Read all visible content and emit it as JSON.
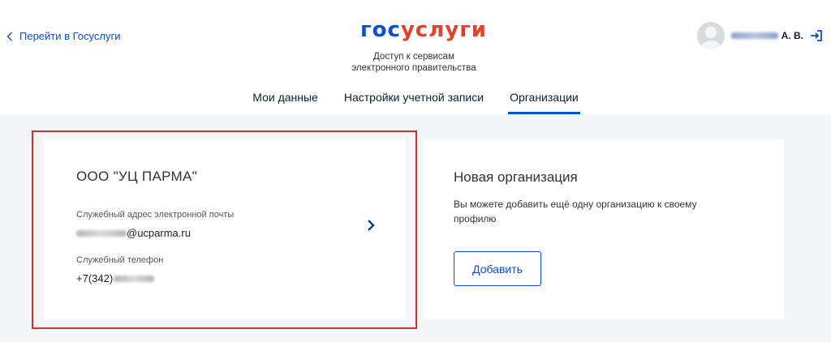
{
  "header": {
    "back_link": "Перейти в Госуслуги",
    "logo_part1": "гос",
    "logo_part2": "услуги",
    "subtitle_line1": "Доступ к сервисам",
    "subtitle_line2": "электронного правительства",
    "user_initials": "А. В."
  },
  "tabs": [
    {
      "label": "Мои данные",
      "active": false
    },
    {
      "label": "Настройки учетной записи",
      "active": false
    },
    {
      "label": "Организации",
      "active": true
    }
  ],
  "organization_card": {
    "name": "ООО \"УЦ ПАРМА\"",
    "email_label": "Служебный адрес электронной почты",
    "email_domain": "@ucparma.ru",
    "phone_label": "Служебный телефон",
    "phone_prefix": "+7(342)"
  },
  "new_org_card": {
    "title": "Новая организация",
    "description": "Вы можете добавить ещё одну организацию к своему профилю",
    "add_button": "Добавить"
  },
  "colors": {
    "accent": "#0d4cd3",
    "logo_red": "#e3412b",
    "highlight_border": "#d32f2f",
    "page_bg": "#f3f5f7"
  }
}
